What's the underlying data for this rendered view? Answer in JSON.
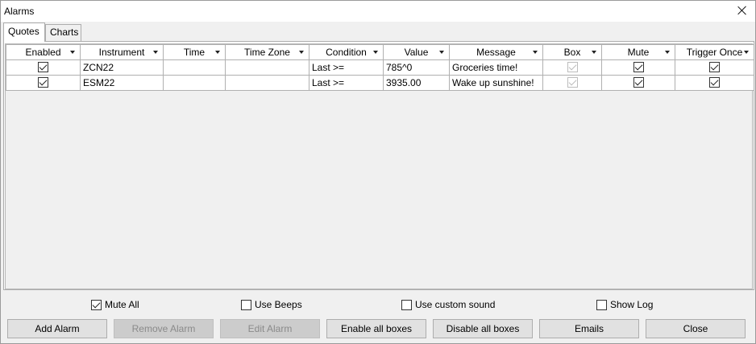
{
  "window": {
    "title": "Alarms"
  },
  "tabs": [
    {
      "label": "Quotes",
      "active": true
    },
    {
      "label": "Charts",
      "active": false
    }
  ],
  "grid": {
    "columns": [
      "Enabled",
      "Instrument",
      "Time",
      "Time Zone",
      "Condition",
      "Value",
      "Message",
      "Box",
      "Mute",
      "Trigger Once"
    ],
    "rows": [
      {
        "enabled": true,
        "instrument": "ZCN22",
        "time": "",
        "time_zone": "",
        "condition": "Last >=",
        "value": "785^0",
        "message": "Groceries time!",
        "box": true,
        "box_disabled": true,
        "mute": true,
        "trigger_once": true
      },
      {
        "enabled": true,
        "instrument": "ESM22",
        "time": "",
        "time_zone": "",
        "condition": "Last >=",
        "value": "3935.00",
        "message": "Wake up sunshine!",
        "box": true,
        "box_disabled": true,
        "mute": true,
        "trigger_once": true
      }
    ]
  },
  "options": {
    "mute_all": {
      "label": "Mute All",
      "checked": true
    },
    "use_beeps": {
      "label": "Use Beeps",
      "checked": false
    },
    "use_custom_sound": {
      "label": "Use custom sound",
      "checked": false
    },
    "show_log": {
      "label": "Show Log",
      "checked": false
    }
  },
  "buttons": {
    "add_alarm": {
      "label": "Add Alarm",
      "enabled": true
    },
    "remove_alarm": {
      "label": "Remove Alarm",
      "enabled": false
    },
    "edit_alarm": {
      "label": "Edit Alarm",
      "enabled": false
    },
    "enable_all_boxes": {
      "label": "Enable all boxes",
      "enabled": true
    },
    "disable_all_boxes": {
      "label": "Disable all boxes",
      "enabled": true
    },
    "emails": {
      "label": "Emails",
      "enabled": true
    },
    "close": {
      "label": "Close",
      "enabled": true
    }
  }
}
